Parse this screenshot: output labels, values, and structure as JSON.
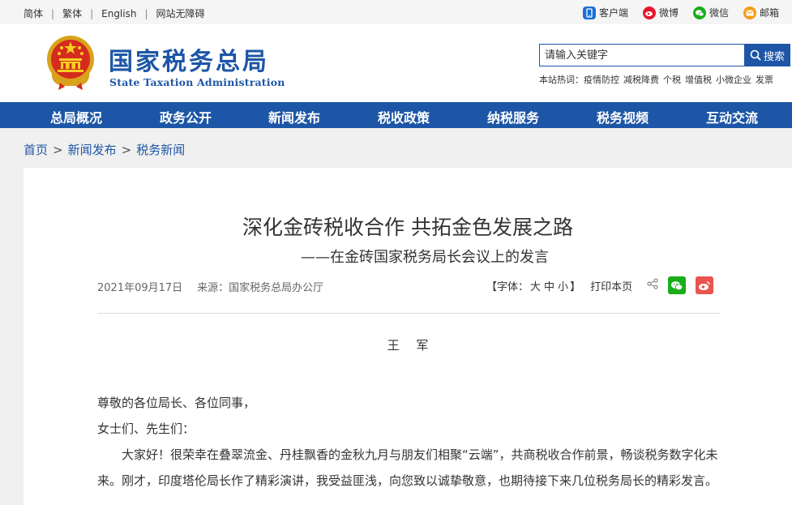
{
  "topbar": {
    "langs": [
      "简体",
      "繁体",
      "English",
      "网站无障碍"
    ],
    "social": [
      {
        "label": "客户端",
        "icon": "mobile-client-icon",
        "color": "#1d6fd6"
      },
      {
        "label": "微博",
        "icon": "weibo-icon",
        "color": "#e6162d"
      },
      {
        "label": "微信",
        "icon": "wechat-icon",
        "color": "#1aad19"
      },
      {
        "label": "邮箱",
        "icon": "mail-icon",
        "color": "#f39c12"
      }
    ]
  },
  "header": {
    "logo_cn": "国家税务总局",
    "logo_en": "State Taxation Administration",
    "search_placeholder": "请输入关键字",
    "search_button": "搜索",
    "hot_label": "本站热词：",
    "hot_words": [
      "疫情防控",
      "减税降费",
      "个税",
      "增值税",
      "小微企业",
      "发票"
    ]
  },
  "nav": [
    "总局概况",
    "政务公开",
    "新闻发布",
    "税收政策",
    "纳税服务",
    "税务视频",
    "互动交流"
  ],
  "breadcrumb": [
    "首页",
    "新闻发布",
    "税务新闻"
  ],
  "article": {
    "title": "深化金砖税收合作 共拓金色发展之路",
    "subtitle": "——在金砖国家税务局长会议上的发言",
    "date": "2021年09月17日",
    "source": "来源：国家税务总局办公厅",
    "font_label": "【字体：",
    "font_sizes": [
      "大",
      "中",
      "小"
    ],
    "font_close": "】",
    "print": "打印本页",
    "author": "王 军",
    "paragraphs": [
      "尊敬的各位局长、各位同事，",
      "女士们、先生们：",
      "大家好！很荣幸在叠翠流金、丹桂飘香的金秋九月与朋友们相聚“云端”，共商税收合作前景，畅谈税务数字化未来。刚才，印度塔伦局长作了精彩演讲，我受益匪浅，向您致以诚挚敬意，也期待接下来几位税务局长的精彩发言。"
    ]
  },
  "colors": {
    "brand_blue": "#1d56a6",
    "wechat_green": "#1aad19",
    "weibo_red": "#e8554e"
  }
}
